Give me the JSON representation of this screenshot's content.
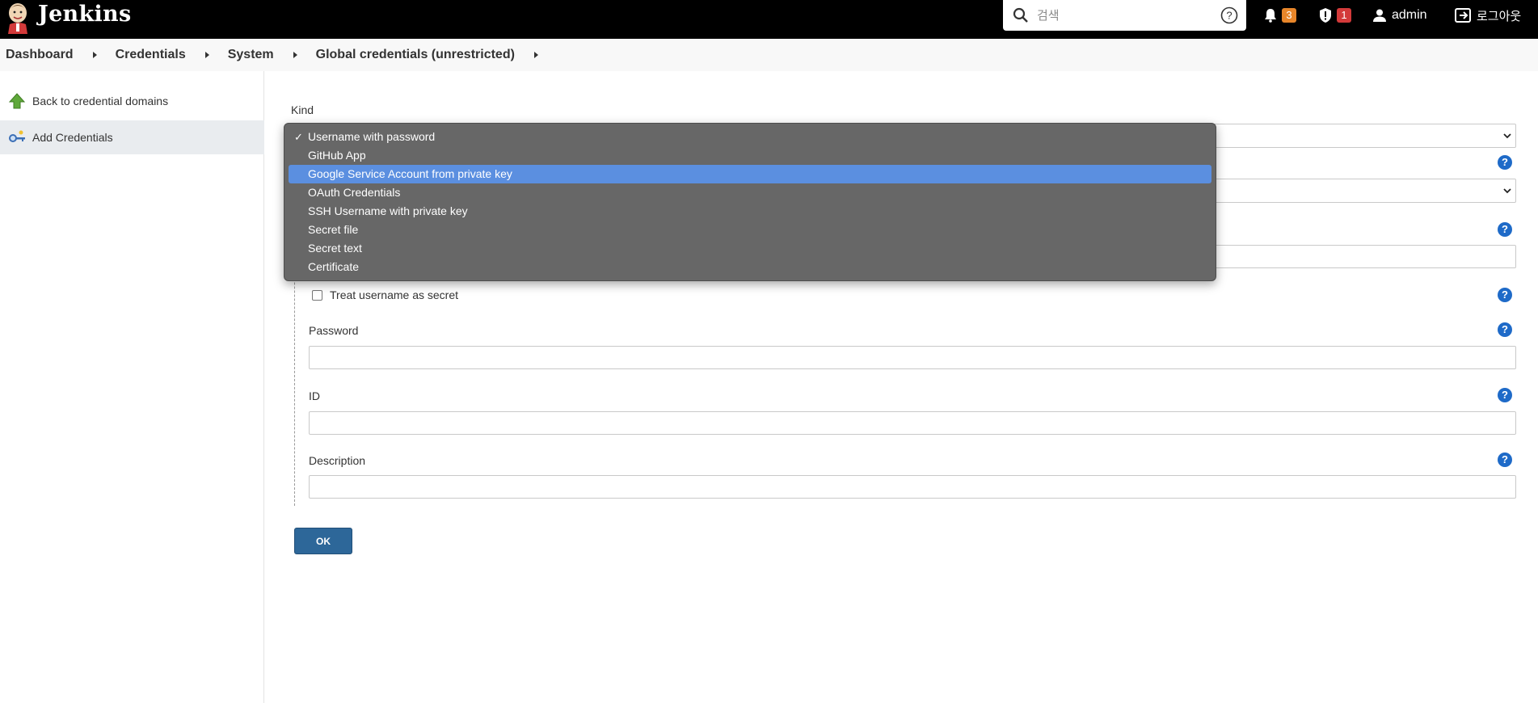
{
  "header": {
    "brand": "Jenkins",
    "search_placeholder": "검색",
    "notifications_count": "3",
    "security_count": "1",
    "user": "admin",
    "logout": "로그아웃"
  },
  "breadcrumb": [
    "Dashboard",
    "Credentials",
    "System",
    "Global credentials (unrestricted)"
  ],
  "sidebar": {
    "items": [
      {
        "label": "Back to credential domains",
        "icon": "up-arrow-icon"
      },
      {
        "label": "Add Credentials",
        "icon": "key-icon"
      }
    ]
  },
  "form": {
    "kind_label": "Kind",
    "treat_username_label": "Treat username as secret",
    "password_label": "Password",
    "id_label": "ID",
    "description_label": "Description",
    "ok_label": "OK",
    "help_glyph": "?"
  },
  "dropdown": {
    "selected": "Username with password",
    "highlighted": "Google Service Account from private key",
    "check": "✓",
    "options": [
      "Username with password",
      "GitHub App",
      "Google Service Account from private key",
      "OAuth Credentials",
      "SSH Username with private key",
      "Secret file",
      "Secret text",
      "Certificate"
    ]
  },
  "colors": {
    "header_bg": "#000000",
    "badge_orange": "#e8862a",
    "badge_red": "#d33a3a",
    "ok_button": "#2d6799",
    "dropdown_bg": "#676767",
    "dropdown_highlight": "#5b8fe0",
    "help_icon": "#1e6ac8"
  }
}
